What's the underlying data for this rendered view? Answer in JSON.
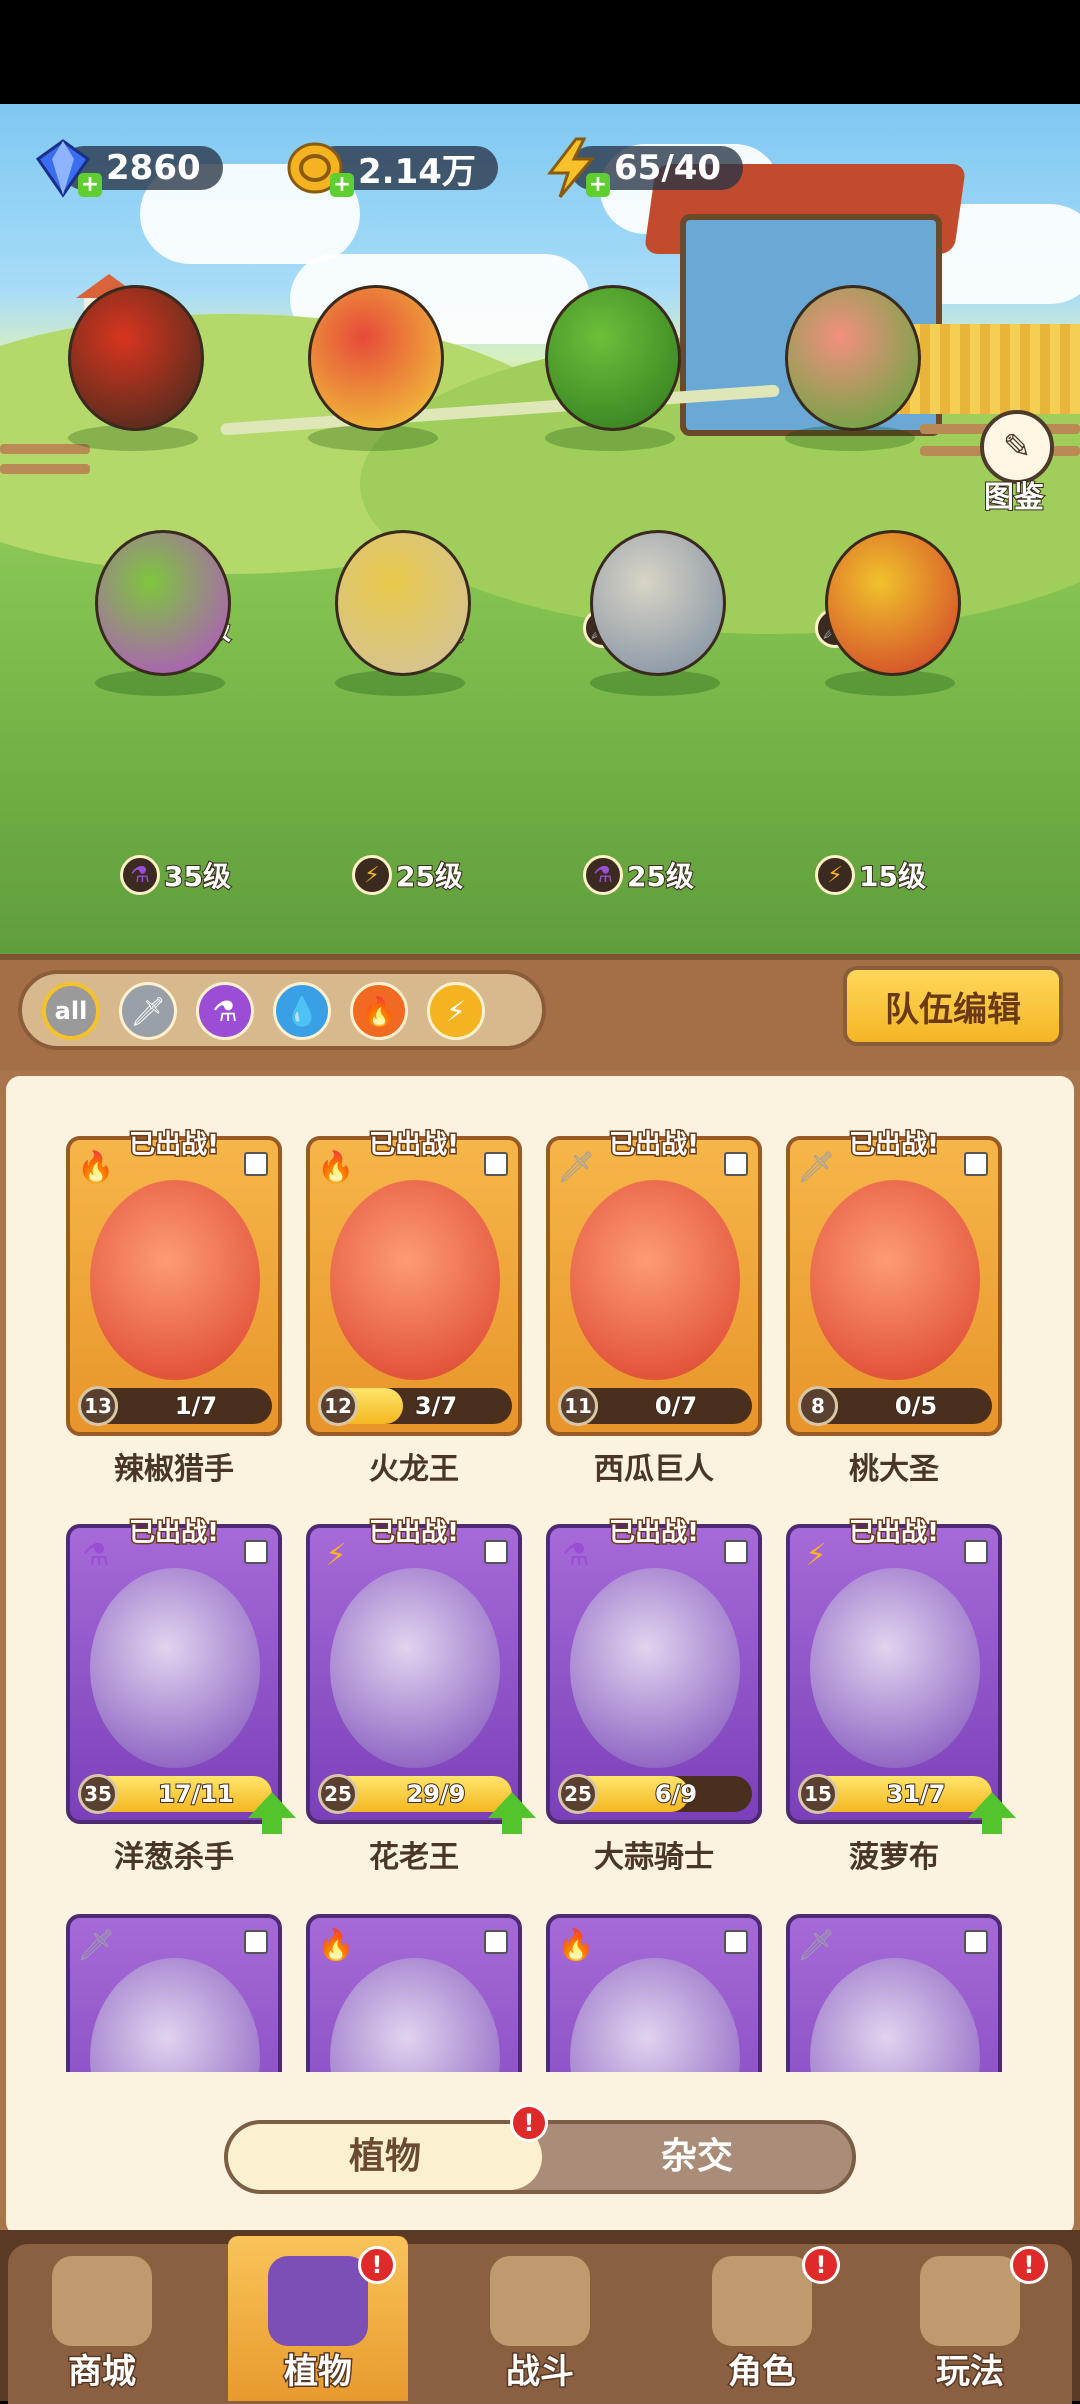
{
  "resources": {
    "gems": "2860",
    "coins": "2.14万",
    "energy": "65/40"
  },
  "guide_button": {
    "label": "图鉴"
  },
  "team_lineup": [
    {
      "name_key": "chili",
      "level": "13级",
      "element": "fire"
    },
    {
      "name_key": "dragon",
      "level": "12级",
      "element": "fire"
    },
    {
      "name_key": "melon",
      "level": "11级",
      "element": "sword"
    },
    {
      "name_key": "peach",
      "level": "8级",
      "element": "sword"
    },
    {
      "name_key": "onion",
      "level": "35级",
      "element": "poison"
    },
    {
      "name_key": "flower",
      "level": "25级",
      "element": "lightning"
    },
    {
      "name_key": "garlic",
      "level": "25级",
      "element": "poison"
    },
    {
      "name_key": "pineapple",
      "level": "15级",
      "element": "lightning"
    }
  ],
  "filters": {
    "items": [
      "all",
      "sword",
      "poison",
      "water",
      "fire",
      "lightning"
    ],
    "selected": "all"
  },
  "team_edit_label": "队伍编辑",
  "deployed_label": "已出战!",
  "plants": [
    {
      "name": "辣椒猎手",
      "level": "13",
      "progress": "1/7",
      "fill": 0.14,
      "rarity": "gold",
      "element": "fire",
      "upgradable": false
    },
    {
      "name": "火龙王",
      "level": "12",
      "progress": "3/7",
      "fill": 0.43,
      "rarity": "gold",
      "element": "fire",
      "upgradable": false
    },
    {
      "name": "西瓜巨人",
      "level": "11",
      "progress": "0/7",
      "fill": 0.0,
      "rarity": "gold",
      "element": "sword",
      "upgradable": false
    },
    {
      "name": "桃大圣",
      "level": "8",
      "progress": "0/5",
      "fill": 0.0,
      "rarity": "gold",
      "element": "sword",
      "upgradable": false
    },
    {
      "name": "洋葱杀手",
      "level": "35",
      "progress": "17/11",
      "fill": 1.0,
      "rarity": "purple",
      "element": "poison",
      "upgradable": true
    },
    {
      "name": "花老王",
      "level": "25",
      "progress": "29/9",
      "fill": 1.0,
      "rarity": "purple",
      "element": "lightning",
      "upgradable": true
    },
    {
      "name": "大蒜骑士",
      "level": "25",
      "progress": "6/9",
      "fill": 0.67,
      "rarity": "purple",
      "element": "poison",
      "upgradable": false
    },
    {
      "name": "菠萝布",
      "level": "15",
      "progress": "31/7",
      "fill": 1.0,
      "rarity": "purple",
      "element": "lightning",
      "upgradable": true
    }
  ],
  "partial_cards": [
    {
      "rarity": "purple",
      "element": "sword"
    },
    {
      "rarity": "purple",
      "element": "fire"
    },
    {
      "rarity": "purple",
      "element": "fire"
    },
    {
      "rarity": "purple",
      "element": "sword"
    }
  ],
  "toggle": {
    "plants": "植物",
    "hybrid": "杂交",
    "badge": "!"
  },
  "nav": [
    {
      "label": "商城",
      "badge": ""
    },
    {
      "label": "植物",
      "badge": "!",
      "active": true
    },
    {
      "label": "战斗",
      "badge": ""
    },
    {
      "label": "角色",
      "badge": "!"
    },
    {
      "label": "玩法",
      "badge": "!"
    }
  ],
  "colors": {
    "fire": "#f26a22",
    "sword": "#9aa0a8",
    "poison": "#9b4dd6",
    "water": "#3aa0e6",
    "lightning": "#f5b321",
    "gold_card": "#f0a63c",
    "purple_card": "#9156cf"
  }
}
